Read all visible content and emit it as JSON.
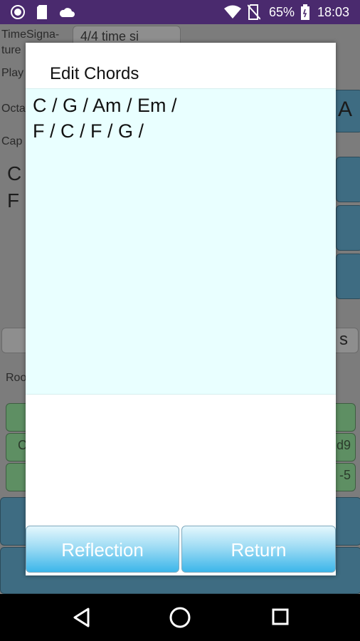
{
  "status_bar": {
    "battery_percent": "65%",
    "time": "18:03",
    "icons": [
      "record-icon",
      "sd-card-icon",
      "cloud-icon",
      "wifi-icon",
      "no-sim-icon",
      "battery-icon"
    ]
  },
  "background": {
    "time_signature_label": "TimeSigna-\nture",
    "time_signature_value": "4/4 time si",
    "play_label": "Play",
    "octave_label": "Octa",
    "capo_label": "Cap",
    "chords_preview_line1": "C",
    "chords_preview_line2": "F",
    "root_label": "Roo",
    "side_letter": "A",
    "side_s": "s",
    "button_fragment_1": "C",
    "button_fragment_2": "d9",
    "button_fragment_3": "-5"
  },
  "dialog": {
    "title": "Edit Chords",
    "chords_text_line1": "C / G / Am / Em /",
    "chords_text_line2": "F / C / F / G /",
    "reflection_button": "Reflection",
    "return_button": "Return"
  },
  "colors": {
    "status_bar": "#4a2a6e",
    "chord_area_bg": "#e9ffff",
    "button_accent": "#3cb6ea"
  }
}
